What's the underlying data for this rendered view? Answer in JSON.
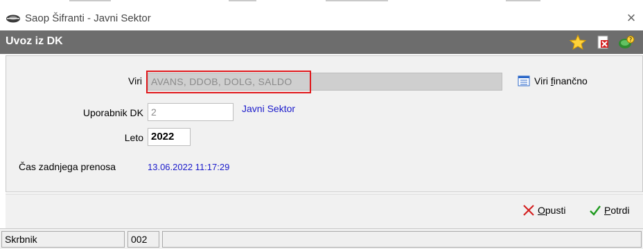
{
  "window": {
    "title": "Saop Šifranti - Javni Sektor",
    "close_symbol": "×"
  },
  "header": {
    "title": "Uvoz iz DK",
    "icons": [
      "star-icon",
      "delete-document-icon",
      "help-icon"
    ]
  },
  "form": {
    "viri": {
      "label": "Viri",
      "value": "AVANS, DDOB, DOLG, SALDO"
    },
    "viri_financno": {
      "label_pre": "Viri ",
      "label_mnemonic": "f",
      "label_post": "inančno"
    },
    "uporabnik": {
      "label": "Uporabnik DK",
      "value": "2",
      "name": "Javni Sektor"
    },
    "leto": {
      "label": "Leto",
      "value": "2022"
    },
    "cas": {
      "label": "Čas zadnjega prenosa",
      "value": "13.06.2022 11:17:29"
    }
  },
  "buttons": {
    "opusti": {
      "mnemonic": "O",
      "rest": "pusti"
    },
    "potrdi": {
      "mnemonic": "P",
      "rest": "otrdi"
    }
  },
  "statusbar": {
    "user": "Skrbnik",
    "code": "002"
  },
  "colors": {
    "header_bg": "#6d6d6d",
    "link": "#1a1acb",
    "highlight": "#e0161a"
  }
}
